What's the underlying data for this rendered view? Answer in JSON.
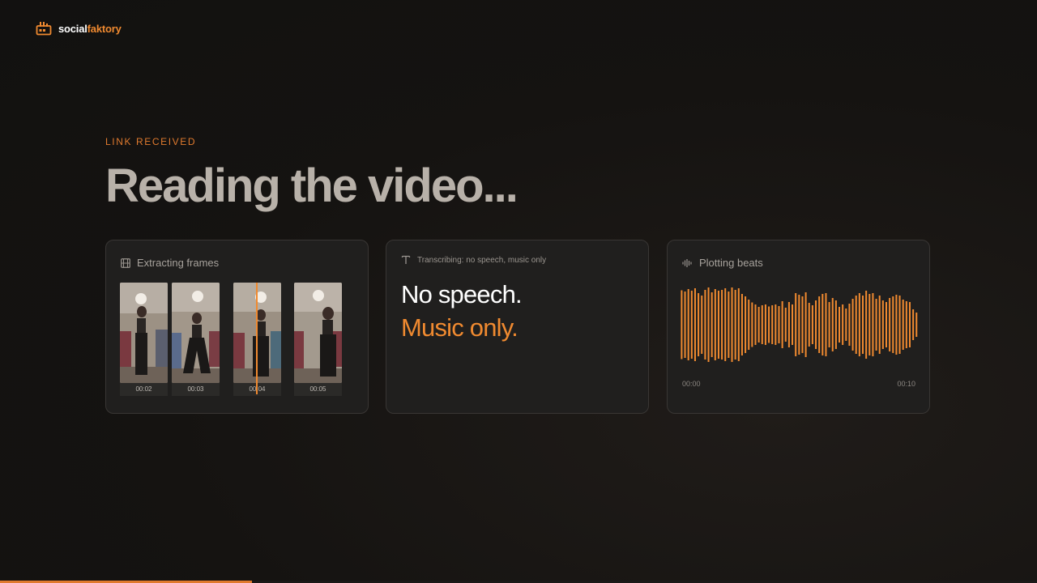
{
  "brand": {
    "name_part1": "social",
    "name_part2": "faktory",
    "accent": "#f08a30",
    "icon": "factory-icon"
  },
  "hero": {
    "eyebrow": "LINK RECEIVED",
    "title": "Reading the video..."
  },
  "cards": {
    "frames": {
      "icon": "film-icon",
      "title": "Extracting frames",
      "items": [
        {
          "time": "00:02"
        },
        {
          "time": "00:03"
        },
        {
          "time": "00:04"
        },
        {
          "time": "00:05"
        }
      ],
      "playhead_time": "00:04"
    },
    "transcript": {
      "icon": "text-icon",
      "status": "Transcribing: no speech, music only",
      "line1": "No speech.",
      "line2": "Music only."
    },
    "beats": {
      "icon": "waveform-icon",
      "title": "Plotting beats",
      "start_time": "00:00",
      "end_time": "00:10",
      "amplitudes": [
        0.85,
        0.82,
        0.88,
        0.84,
        0.9,
        0.78,
        0.72,
        0.86,
        0.92,
        0.8,
        0.88,
        0.84,
        0.86,
        0.9,
        0.82,
        0.92,
        0.86,
        0.9,
        0.76,
        0.7,
        0.62,
        0.55,
        0.5,
        0.44,
        0.48,
        0.5,
        0.45,
        0.48,
        0.5,
        0.46,
        0.58,
        0.42,
        0.56,
        0.5,
        0.78,
        0.74,
        0.7,
        0.8,
        0.54,
        0.48,
        0.6,
        0.7,
        0.76,
        0.78,
        0.56,
        0.66,
        0.6,
        0.44,
        0.5,
        0.4,
        0.52,
        0.64,
        0.72,
        0.78,
        0.72,
        0.84,
        0.76,
        0.78,
        0.64,
        0.72,
        0.6,
        0.56,
        0.66,
        0.7,
        0.74,
        0.72,
        0.62,
        0.58,
        0.56,
        0.38,
        0.3
      ]
    }
  },
  "progress": {
    "fraction": 0.243
  }
}
